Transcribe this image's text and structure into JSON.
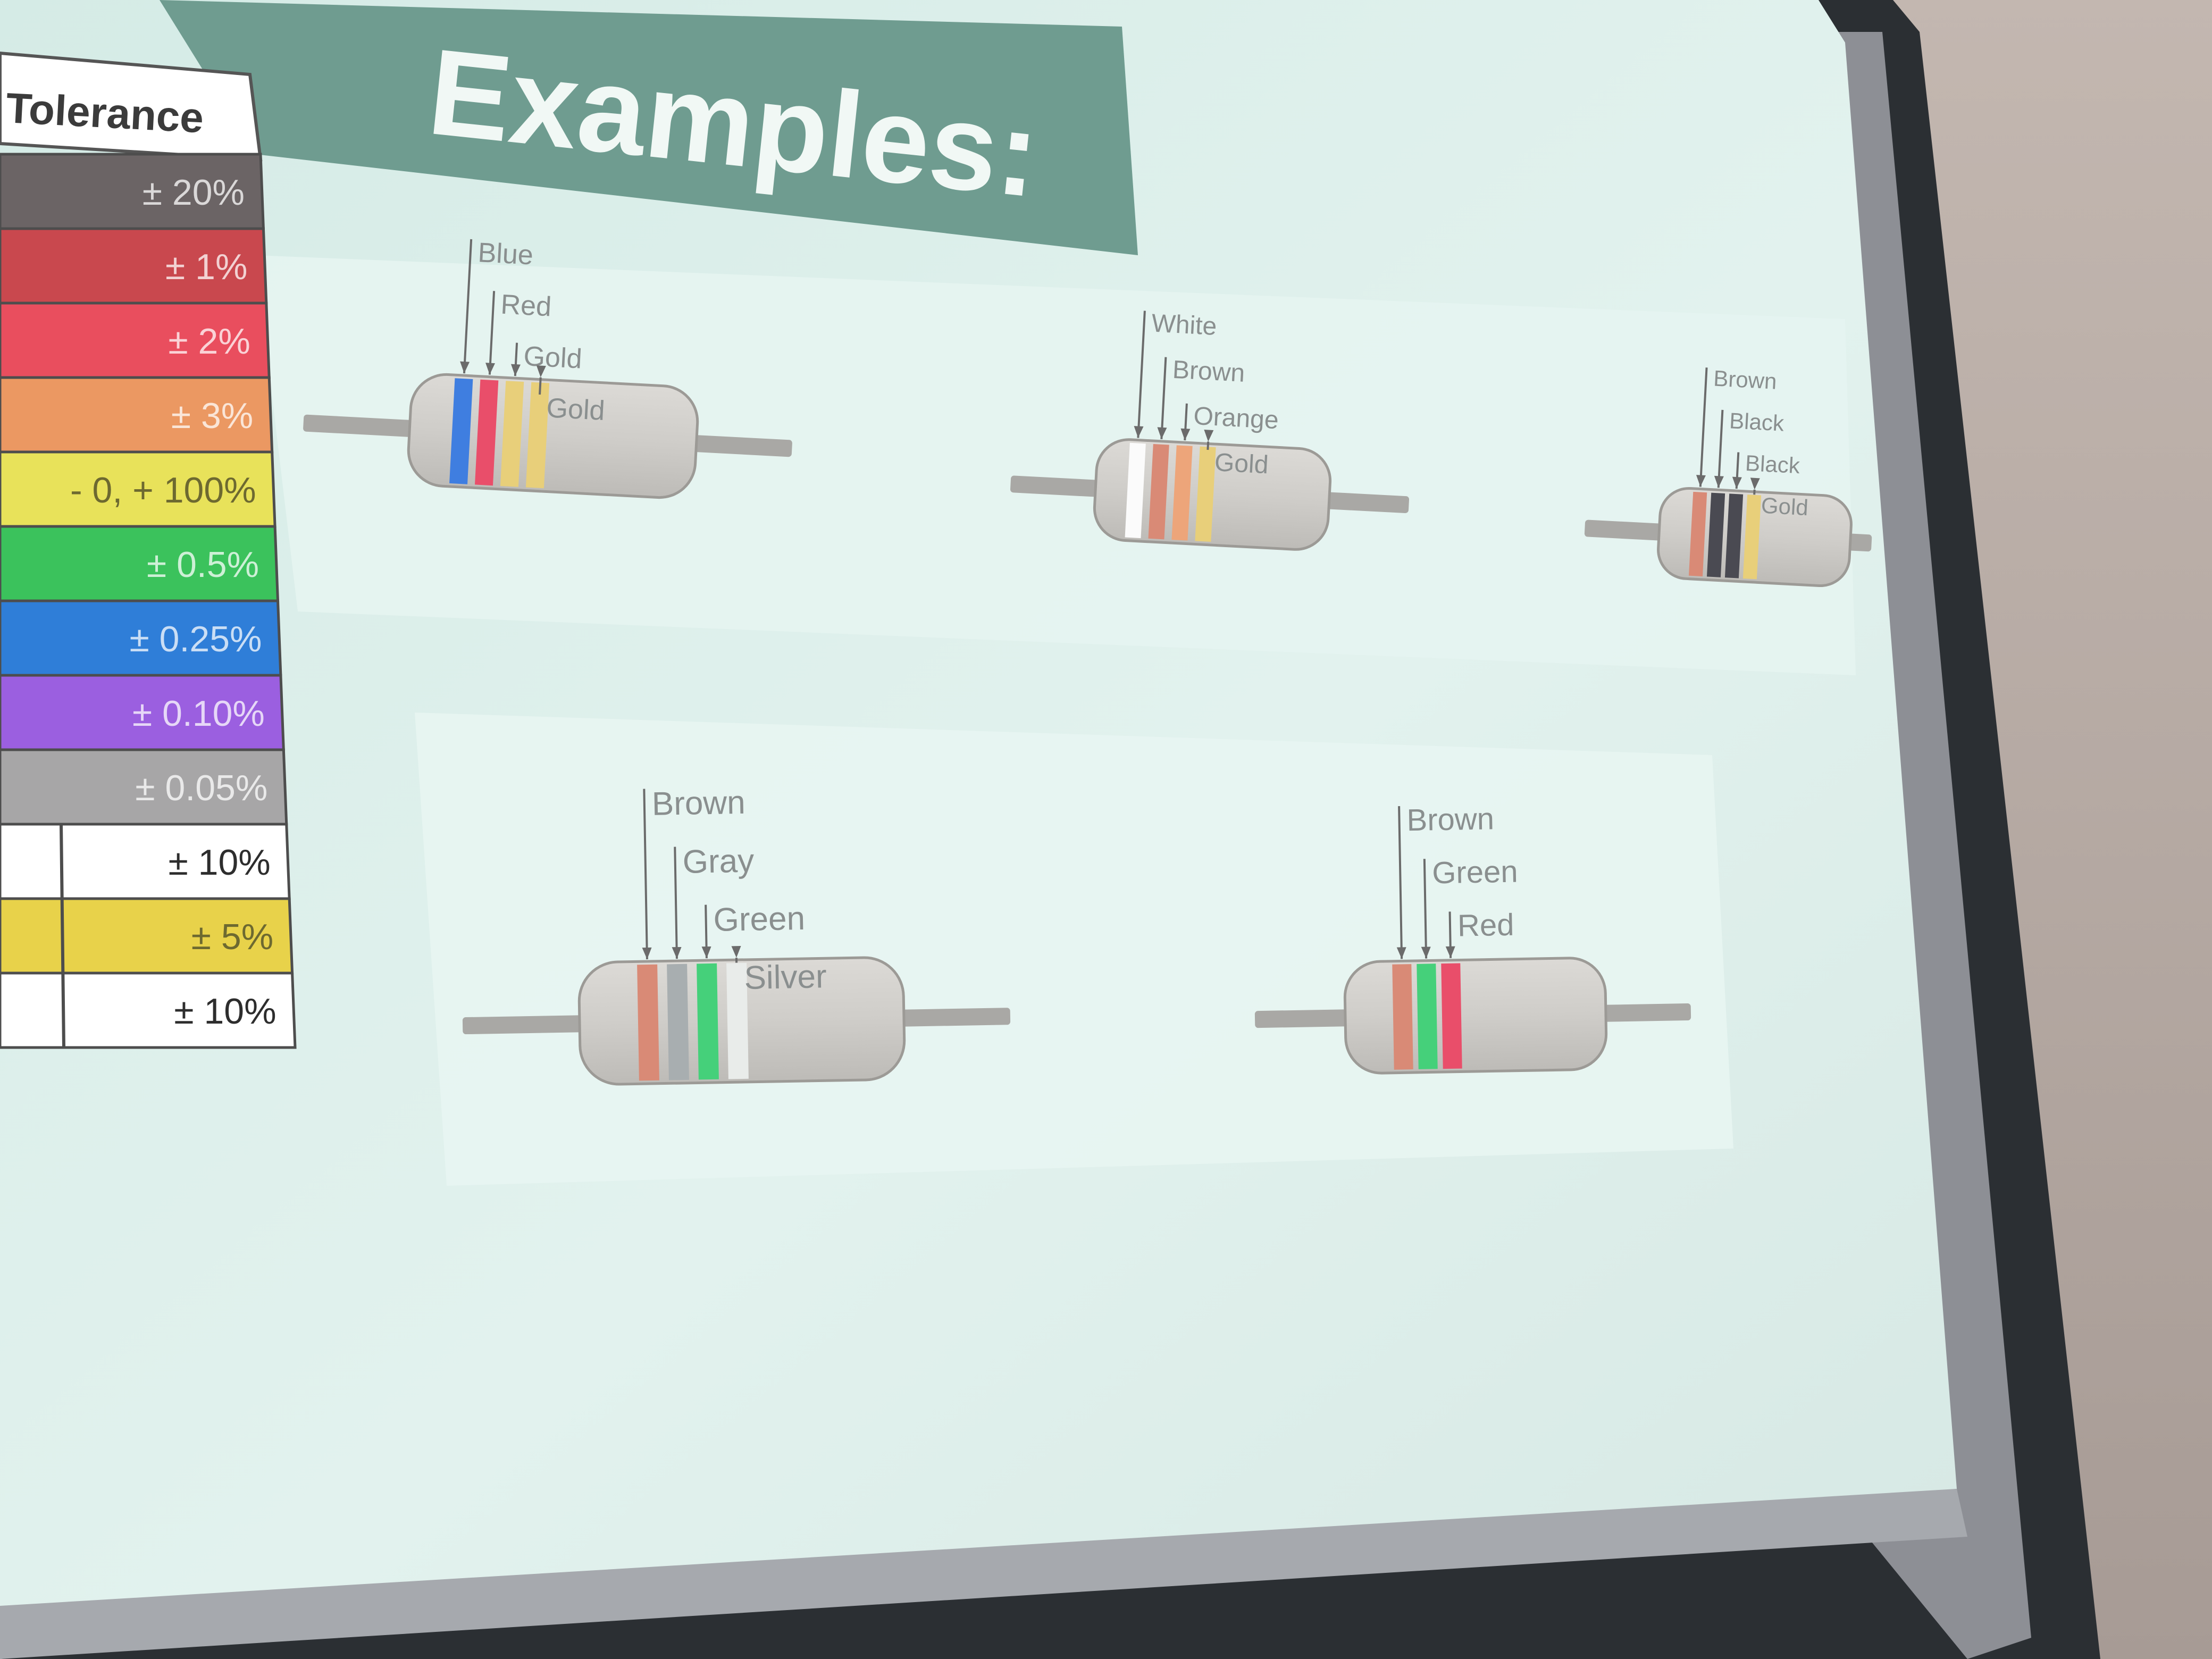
{
  "slide": {
    "title": "Examples:",
    "tolerance_table": {
      "header": "Tolerance",
      "rows": [
        {
          "label": "± 20%",
          "color": "#6b6465"
        },
        {
          "label": "± 1%",
          "color": "#c9484e"
        },
        {
          "label": "± 2%",
          "color": "#e94e5e"
        },
        {
          "label": "± 3%",
          "color": "#eb9862"
        },
        {
          "label": "- 0, + 100%",
          "color": "#e8e25a"
        },
        {
          "label": "± 0.5%",
          "color": "#3bc25c"
        },
        {
          "label": "± 0.25%",
          "color": "#2f7ed8"
        },
        {
          "label": "± 0.10%",
          "color": "#9b5fe0"
        },
        {
          "label": "± 0.05%",
          "color": "#a7a6a7"
        },
        {
          "label": "± 10%",
          "color": "#ffffff"
        },
        {
          "label": "± 5%",
          "color": "#e8d24a"
        },
        {
          "label": "± 10%",
          "color": "#ffffff"
        }
      ]
    },
    "resistors": [
      {
        "bands": [
          {
            "label": "Blue",
            "color": "#3f7ee0"
          },
          {
            "label": "Red",
            "color": "#e94e6a"
          },
          {
            "label": "Gold",
            "color": "#e8cf7a"
          },
          {
            "label": "Gold",
            "color": "#e8cf7a"
          }
        ]
      },
      {
        "bands": [
          {
            "label": "White",
            "color": "#fbfbfb"
          },
          {
            "label": "Brown",
            "color": "#d98a76"
          },
          {
            "label": "Orange",
            "color": "#eda57a"
          },
          {
            "label": "Gold",
            "color": "#e8cf7a"
          }
        ]
      },
      {
        "bands": [
          {
            "label": "Brown",
            "color": "#d98a76"
          },
          {
            "label": "Black",
            "color": "#4a4a52"
          },
          {
            "label": "Black",
            "color": "#4a4a52"
          },
          {
            "label": "Gold",
            "color": "#e8cf7a"
          }
        ]
      },
      {
        "bands": [
          {
            "label": "Brown",
            "color": "#d98a76"
          },
          {
            "label": "Gray",
            "color": "#a8aeb0"
          },
          {
            "label": "Green",
            "color": "#45d07a"
          },
          {
            "label": "Silver",
            "color": "#e9ecea"
          }
        ]
      },
      {
        "bands": [
          {
            "label": "Brown",
            "color": "#d98a76"
          },
          {
            "label": "Green",
            "color": "#45d07a"
          },
          {
            "label": "Red",
            "color": "#e94e6a"
          }
        ]
      }
    ]
  },
  "colors": {
    "title_banner": "#6f9c90",
    "screen": "#dbeeea",
    "resistor_body": "#cfcdc9",
    "lead": "#a9a8a5",
    "frame": "#2b2f33"
  }
}
